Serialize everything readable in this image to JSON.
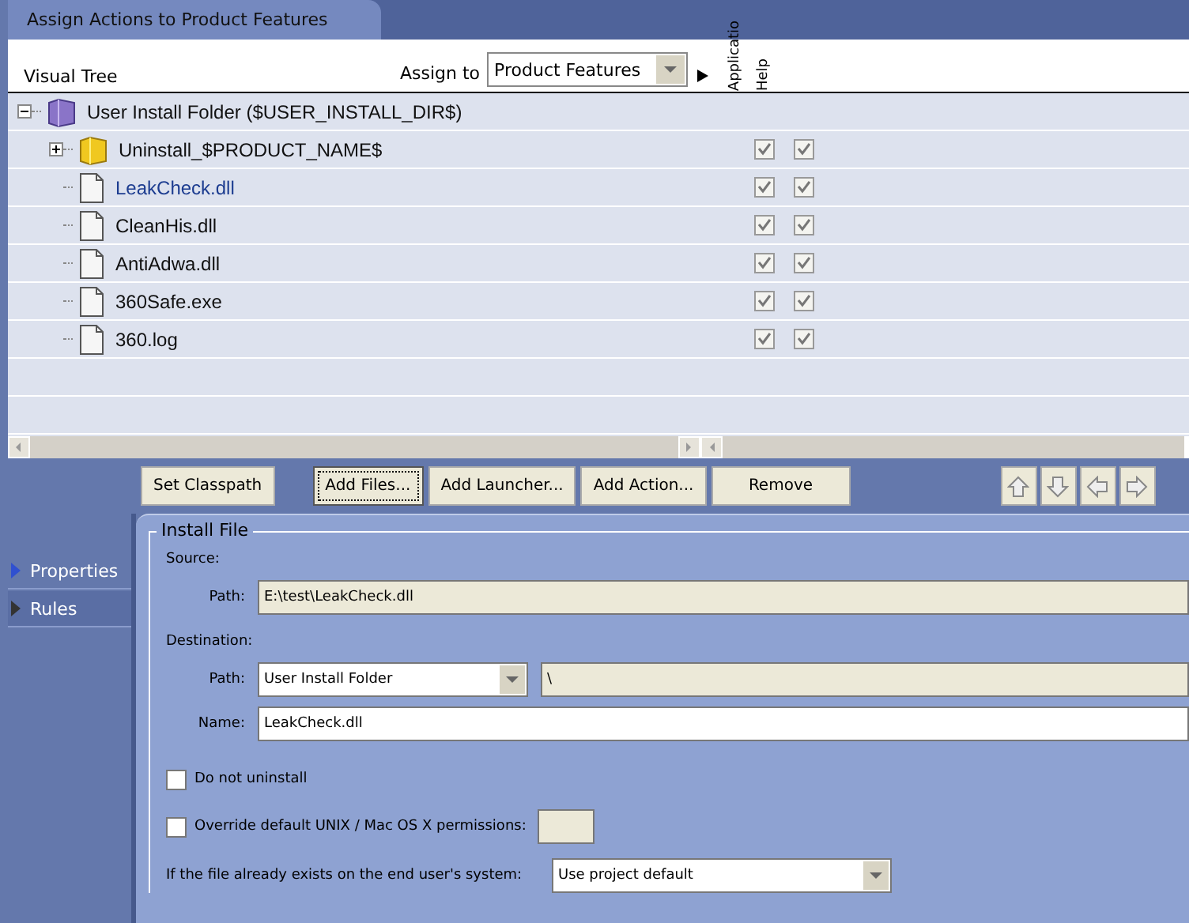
{
  "tab": {
    "label": "Assign Actions to Product Features",
    "selected": true
  },
  "header": {
    "tree_label": "Visual Tree",
    "assign_label": "Assign to",
    "assign_value": "Product Features",
    "columns": [
      "Applicatio",
      "Help"
    ]
  },
  "tree": [
    {
      "label": "User Install Folder ($USER_INSTALL_DIR$)",
      "kind": "install_folder",
      "expanded": true,
      "selected": false,
      "children": [
        {
          "label": "Uninstall_$PRODUCT_NAME$",
          "kind": "folder",
          "expanded": false,
          "selected": false,
          "application": true,
          "help": true
        },
        {
          "label": "LeakCheck.dll",
          "kind": "file",
          "selected": true,
          "application": true,
          "help": true
        },
        {
          "label": "CleanHis.dll",
          "kind": "file",
          "selected": false,
          "application": true,
          "help": true
        },
        {
          "label": "AntiAdwa.dll",
          "kind": "file",
          "selected": false,
          "application": true,
          "help": true
        },
        {
          "label": "360Safe.exe",
          "kind": "file",
          "selected": false,
          "application": true,
          "help": true
        },
        {
          "label": "360.log",
          "kind": "file",
          "selected": false,
          "application": true,
          "help": true
        }
      ]
    }
  ],
  "buttons": [
    {
      "label": "Set Classpath",
      "focused": false
    },
    {
      "label": "Add Files...",
      "focused": true
    },
    {
      "label": "Add Launcher...",
      "focused": false
    },
    {
      "label": "Add Action...",
      "focused": false
    },
    {
      "label": "Remove",
      "focused": false
    }
  ],
  "sidebar": [
    {
      "label": "Properties",
      "selected": true
    },
    {
      "label": "Rules",
      "selected": false
    }
  ],
  "form": {
    "title": "Install File",
    "source_label": "Source:",
    "source_path": {
      "label": "Path:",
      "value": "E:\\test\\LeakCheck.dll"
    },
    "destination_label": "Destination:",
    "destination_path": {
      "label": "Path:",
      "dropdown": "User Install Folder",
      "value": "\\"
    },
    "name": {
      "label": "Name:",
      "value": "LeakCheck.dll"
    },
    "checkboxes": [
      {
        "label": "Do not uninstall",
        "checked": false,
        "kind": "plain"
      },
      {
        "label": "Override default UNIX / Mac OS X permissions:",
        "checked": false,
        "kind": "with_field"
      }
    ],
    "existing": {
      "label": "If the file already exists on the end user's system:",
      "value": "Use project default"
    }
  }
}
